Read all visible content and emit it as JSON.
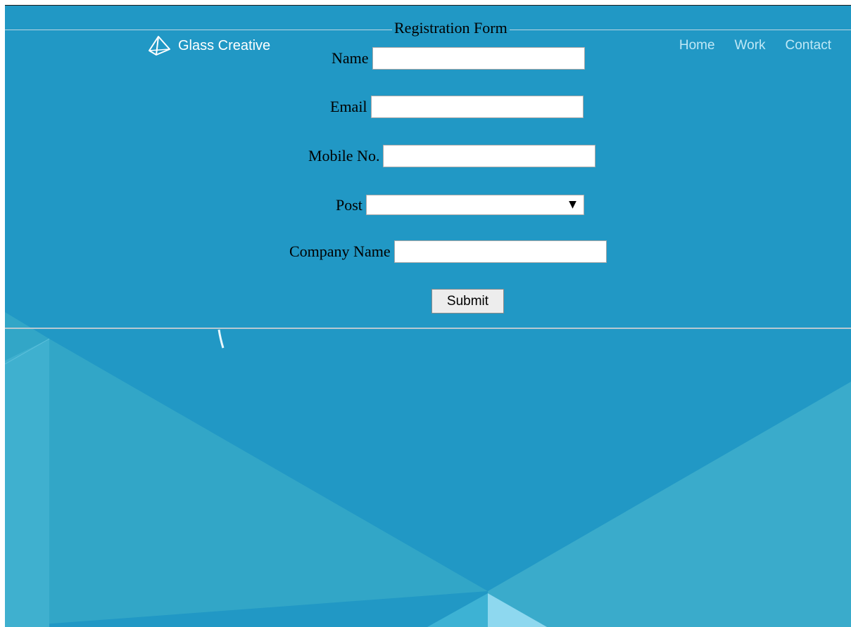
{
  "header": {
    "brand": "Glass Creative",
    "brand_icon": "pyramid-logo-icon",
    "nav": [
      "Home",
      "Work",
      "Contact"
    ]
  },
  "form": {
    "legend": "Registration Form",
    "fields": {
      "name": {
        "label": "Name",
        "value": ""
      },
      "email": {
        "label": "Email",
        "value": ""
      },
      "mobile": {
        "label": "Mobile No.",
        "value": ""
      },
      "post": {
        "label": "Post",
        "selected": ""
      },
      "company": {
        "label": "Company Name",
        "value": ""
      }
    },
    "submit_label": "Submit"
  },
  "colors": {
    "background": "#2198c5",
    "facet_light": "#3aabcb",
    "nav_text": "#bfe8f6"
  }
}
